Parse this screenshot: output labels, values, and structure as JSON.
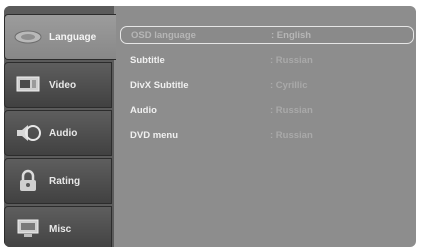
{
  "sidebar": {
    "tabs": [
      {
        "label": "Language",
        "icon": "speech-bubble-icon",
        "active": true
      },
      {
        "label": "Video",
        "icon": "monitor-icon",
        "active": false
      },
      {
        "label": "Audio",
        "icon": "speaker-icon",
        "active": false
      },
      {
        "label": "Rating",
        "icon": "padlock-icon",
        "active": false
      },
      {
        "label": "Misc",
        "icon": "display-icon",
        "active": false
      }
    ]
  },
  "settings": [
    {
      "label": "OSD language",
      "value": ": English",
      "selected": true
    },
    {
      "label": "Subtitle",
      "value": ": Russian",
      "selected": false
    },
    {
      "label": "DivX Subtitle",
      "value": ": Cyrillic",
      "selected": false
    },
    {
      "label": "Audio",
      "value": ": Russian",
      "selected": false
    },
    {
      "label": "DVD menu",
      "value": ": Russian",
      "selected": false
    }
  ],
  "colors": {
    "panel": "#8d8d8d",
    "sidebar": "#5b5b5b",
    "highlight_border": "#e6e6e6"
  }
}
